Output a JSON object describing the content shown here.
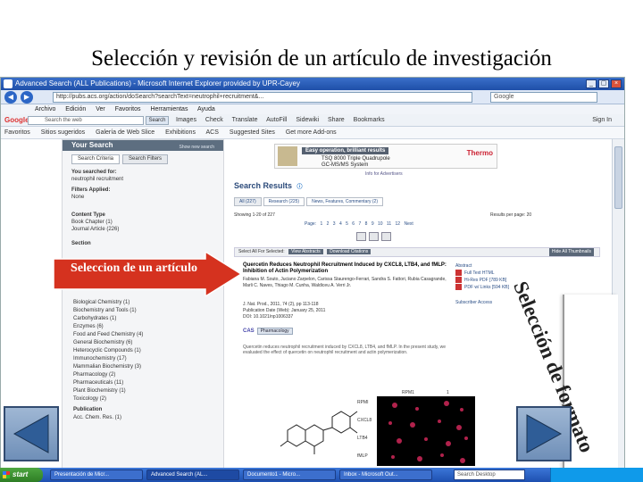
{
  "slide": {
    "title": "Selección y revisión  de  un artículo de investigación",
    "arrow_label": "Seleccion de un artículo",
    "side_label": "Selección de formato"
  },
  "browser": {
    "title": "Advanced Search (ALL Publications) - Microsoft Internet Explorer provided by UPR-Cayey",
    "url": "http://pubs.acs.org/action/doSearch?searchText=neutrophil+recruitment&...",
    "search_engine": "Google",
    "menu": [
      "Archivo",
      "Edición",
      "Ver",
      "Favoritos",
      "Herramientas",
      "Ayuda"
    ],
    "google_bar": {
      "logo": "Google",
      "field_placeholder": "Search the web",
      "search_button": "Search",
      "items": [
        "Images",
        "Check",
        "Translate",
        "AutoFill",
        "Sidewiki",
        "Share",
        "Bookmarks"
      ],
      "right": "Sign In"
    },
    "favorites": [
      "Favoritos",
      "Sitios sugeridos",
      "Galería de Web Slice",
      "Exhibitions",
      "ACS",
      "Suggested Sites",
      "Get more Add-ons"
    ]
  },
  "sidebar": {
    "header": "Your Search",
    "header_link": "Show new search",
    "tabs": [
      "Search Criteria",
      "Search Filters"
    ],
    "you_searched_label": "You searched for:",
    "you_searched_value": "neutrophil recruitment",
    "filters_label": "Filters Applied:",
    "filters_value": "None",
    "content_type_label": "Content Type",
    "content_types": [
      "Book Chapter (1)",
      "Journal Article (226)"
    ],
    "section_label": "Section",
    "facets": [
      "Biological Chemistry (1)",
      "Biochemistry and Tools (1)",
      "Carbohydrates (1)",
      "Enzymes (6)",
      "Food and Feed Chemistry (4)",
      "General Biochemistry (6)",
      "Heterocyclic Compounds (1)",
      "Immunochemistry (17)",
      "Mammalian Biochemistry (3)",
      "Pharmacology (2)",
      "Pharmaceuticals (11)",
      "Plant Biochemistry (1)",
      "Toxicology (2)"
    ],
    "publication_label": "Publication",
    "publication_value": "Acc. Chem. Res. (1)"
  },
  "ad": {
    "headline": "Easy operation, brilliant results",
    "line2": "TSQ 8000 Triple Quadrupole",
    "line3": "GC-MS/MS System",
    "brand": "Thermo",
    "info": "Info for Advertisers"
  },
  "results": {
    "title": "Search Results",
    "tabs": [
      "All (227)",
      "Research (225)",
      "News, Features, Commentary (2)"
    ],
    "showing": "Showing 1-20 of 227",
    "per_page": "Results per page: 20",
    "pager": "Page: 1  2  3  4  5  6  7  8  9  10  11  12  Next",
    "toolbar_select": "Select All   For Selected:",
    "toolbar_btn1": "View Abstracts",
    "toolbar_btn2": "Download Citations",
    "toolbar_hide": "Hide All Thumbnails"
  },
  "article": {
    "title": "Quercetin Reduces Neutrophil Recruitment Induced by CXCL8, LTB4, and fMLP: Inhibition of Actin Polymerization",
    "authors": "Fabiana M. Souto, Juciano Zarpelon, Carissa Staurengo-Ferrari, Sandra S. Fattori, Rubia Casagrande, Marli C. Naves, Thiago M. Cunha, Waldiceu A. Verri Jr.",
    "pub_date": "J. Nat. Prod., 2011, 74 (2), pp 113-118",
    "pub_date2": "Publication Date (Web): January 25, 2011",
    "doi": "DOI: 10.1021/np1006337",
    "tag": "Pharmacology",
    "links": [
      "Abstract",
      "Full Text HTML",
      "Hi-Res PDF [789 KB]",
      "PDF w/ Links [594 KB]"
    ],
    "subscriber": "Subscriber Access",
    "abstract": "Quercetin reduces neutrophil recruitment induced by CXCL8, LTB4, and fMLP. In the present study, we evaluated the effect of quercetin on neutrophil recruitment and actin polymerization.",
    "panel_header": "RPM1",
    "panel_header2": "1",
    "panel_rows": [
      "RPMI",
      "CXCL8",
      "LTB4",
      "fMLP"
    ]
  },
  "taskbar": {
    "start": "start",
    "tasks": [
      "Presentación de Micr...",
      "Advanced Search (AL...",
      "Documento1 - Micro...",
      "Inbox - Microsoft Out..."
    ],
    "search_placeholder": "Search Desktop"
  },
  "colors": {
    "arrow_red": "#d5321f",
    "taskbar_blue": "#245edb",
    "start_green": "#3a9a33",
    "result_title": "#2b4a7a"
  }
}
